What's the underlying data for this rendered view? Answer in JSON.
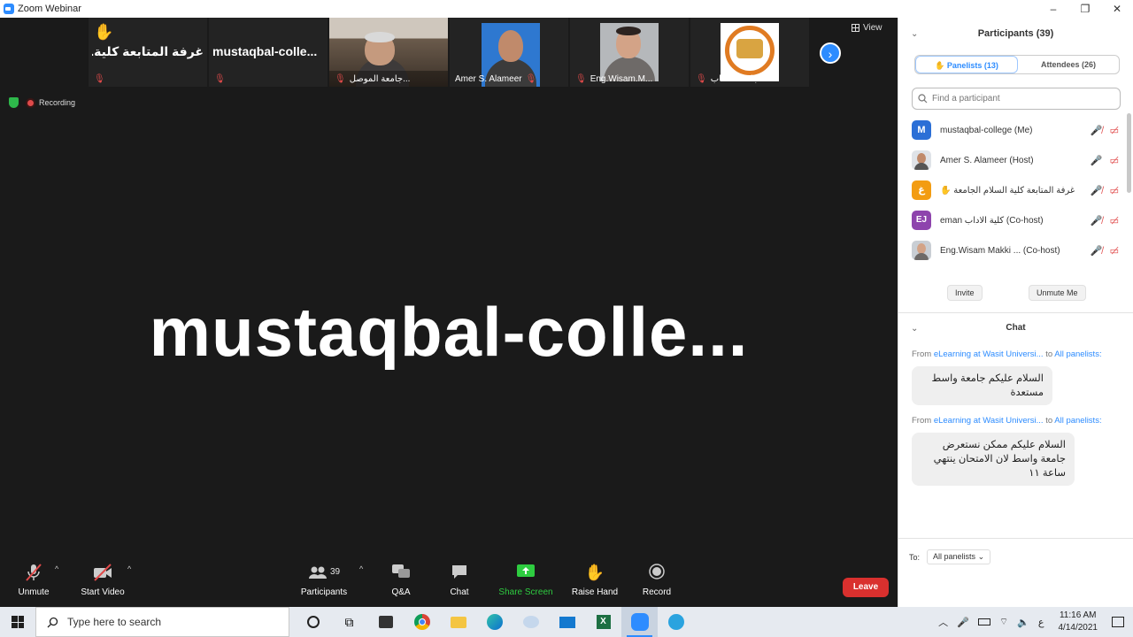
{
  "window": {
    "title": "Zoom Webinar",
    "controls": [
      "–",
      "❐",
      "✕"
    ]
  },
  "gallery": {
    "tiles": [
      {
        "big": "غرفة المتابعة كلية...",
        "caption": "",
        "hand": "✋",
        "type": "name"
      },
      {
        "big": "mustaqbal-colle...",
        "caption": "",
        "type": "name"
      },
      {
        "big": "",
        "caption": "جامعة الموصل...",
        "type": "photo1"
      },
      {
        "big": "",
        "caption": "Amer S. Alameer",
        "type": "photo2"
      },
      {
        "big": "",
        "caption": "Eng.Wisam.M...",
        "type": "photo3"
      },
      {
        "big": "",
        "caption": "جامعة الكتاب - ...",
        "type": "logo"
      }
    ],
    "next_icon": "›",
    "view_label": "View"
  },
  "status": {
    "recording_label": "Recording"
  },
  "speaker": {
    "name": "mustaqbal-colle..."
  },
  "toolbar": {
    "unmute": "Unmute",
    "start_video": "Start Video",
    "participants": "Participants",
    "participants_count": "39",
    "qa": "Q&A",
    "chat": "Chat",
    "share": "Share Screen",
    "raise_hand": "Raise Hand",
    "record": "Record",
    "leave": "Leave"
  },
  "participants_panel": {
    "title": "Participants (39)",
    "tabs": {
      "panelists": "Panelists (13)",
      "attendees": "Attendees (26)"
    },
    "search_placeholder": "Find a participant",
    "rows": [
      {
        "initial": "M",
        "name": "mustaqbal-college (Me)",
        "color": "#2b6fd6"
      },
      {
        "initial": "",
        "name": "Amer S. Alameer (Host)",
        "color": "#7a8a99"
      },
      {
        "initial": "غ",
        "name": "غرفة المتابعة كلية السلام الجامعة ✋",
        "color": "#f39c12"
      },
      {
        "initial": "EJ",
        "name": "eman كلية الاداب (Co-host)",
        "color": "#8e44ad"
      },
      {
        "initial": "",
        "name": "Eng.Wisam Makki ...  (Co-host)",
        "color": "#9aa5b1"
      }
    ],
    "invite": "Invite",
    "unmute_me": "Unmute Me"
  },
  "chat": {
    "title": "Chat",
    "messages": [
      {
        "from_prefix": "From",
        "sender": "eLearning at Wasit Universi...",
        "to_word": "to",
        "recipient": "All panelists:",
        "text": "السلام عليكم  جامعة واسط مستعدة"
      },
      {
        "from_prefix": "From",
        "sender": "eLearning at Wasit Universi...",
        "to_word": "to",
        "recipient": "All panelists:",
        "text": "السلام عليكم ممكن نستعرض جامعة واسط لان الامتحان ينتهي ساعة ١١"
      }
    ],
    "to_label": "To:",
    "to_value": "All panelists"
  },
  "taskbar": {
    "search_placeholder": "Type here to search",
    "time": "11:16 AM",
    "date": "4/14/2021",
    "lang": "ع"
  }
}
